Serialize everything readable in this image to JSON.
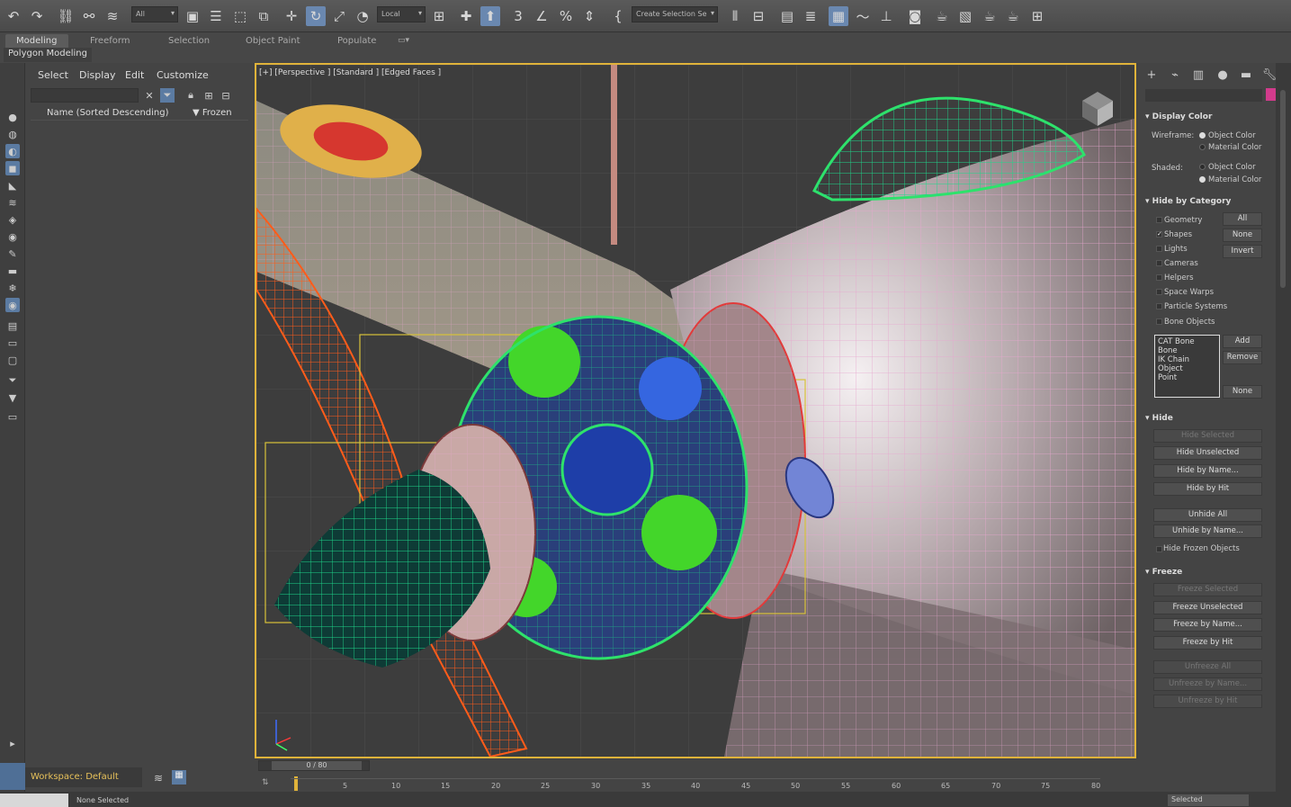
{
  "toolbar": {
    "filter_dropdown": "All",
    "coord_dropdown": "Local",
    "selection_set_dropdown": "Create Selection Se",
    "undo_icon": "undo-icon",
    "redo_icon": "redo-icon"
  },
  "ribbon": {
    "tabs": [
      "Modeling",
      "Freeform",
      "Selection",
      "Object Paint",
      "Populate"
    ],
    "active_tab": "Modeling",
    "sub_label": "Polygon Modeling"
  },
  "explorer": {
    "menu": [
      "Select",
      "Display",
      "Edit",
      "Customize"
    ],
    "column_name": "Name (Sorted Descending)",
    "column_frozen": "▼ Frozen",
    "workspace": "Workspace: Default"
  },
  "viewport": {
    "label": "[+] [Perspective ] [Standard ] [Edged Faces ]"
  },
  "command_panel": {
    "display_color": {
      "title": "Display Color",
      "wireframe_label": "Wireframe:",
      "shaded_label": "Shaded:",
      "wireframe_options": [
        "Object Color",
        "Material Color"
      ],
      "shaded_options": [
        "Object Color",
        "Material Color"
      ]
    },
    "hide_by_category": {
      "title": "Hide by Category",
      "categories": [
        "Geometry",
        "Shapes",
        "Lights",
        "Cameras",
        "Helpers",
        "Space Warps",
        "Particle Systems",
        "Bone Objects"
      ],
      "buttons": [
        "All",
        "None",
        "Invert"
      ],
      "list_items": [
        "CAT Bone",
        "Bone",
        "IK Chain Object",
        "Point"
      ],
      "list_buttons": [
        "Add",
        "Remove",
        "None"
      ]
    },
    "hide": {
      "title": "Hide",
      "buttons": [
        "Hide Selected",
        "Hide Unselected",
        "Hide by Name...",
        "Hide by Hit",
        "Unhide All",
        "Unhide by Name..."
      ],
      "checkbox": "Hide Frozen Objects"
    },
    "freeze": {
      "title": "Freeze",
      "buttons": [
        "Freeze Selected",
        "Freeze Unselected",
        "Freeze by Name...",
        "Freeze by Hit",
        "Unfreeze All",
        "Unfreeze by Name...",
        "Unfreeze by Hit"
      ]
    }
  },
  "timeline": {
    "frame_display": "0 / 80",
    "ticks": [
      "5",
      "10",
      "15",
      "20",
      "25",
      "30",
      "35",
      "40",
      "45",
      "50",
      "55",
      "60",
      "65",
      "70",
      "75",
      "80"
    ]
  },
  "status": {
    "selection": "None Selected",
    "key_mode": "Selected"
  },
  "colors": {
    "viewport_border": "#e0b33a",
    "active_tool": "#6a88b0",
    "swatch": "#d23b8c"
  }
}
